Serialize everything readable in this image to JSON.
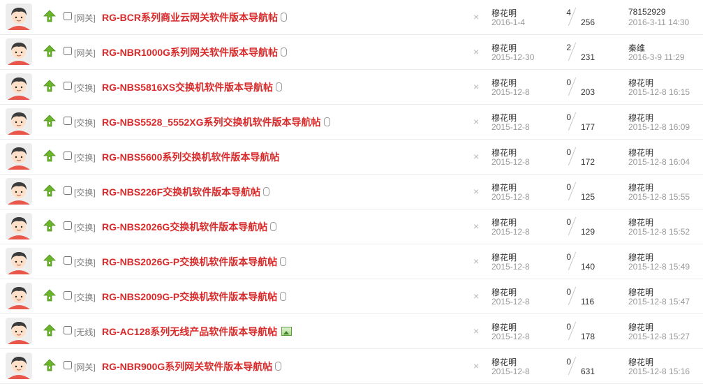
{
  "threads": [
    {
      "category": "[网关]",
      "title": "RG-BCR系列商业云网关软件版本导航帖",
      "attachment": "clip",
      "author": "穆花明",
      "post_date": "2016-1-4",
      "replies": "4",
      "views": "256",
      "last_user": "78152929",
      "last_time": "2016-3-11 14:30"
    },
    {
      "category": "[网关]",
      "title": "RG-NBR1000G系列网关软件版本导航帖",
      "attachment": "clip",
      "author": "穆花明",
      "post_date": "2015-12-30",
      "replies": "2",
      "views": "231",
      "last_user": "秦维",
      "last_time": "2016-3-9 11:29"
    },
    {
      "category": "[交换]",
      "title": "RG-NBS5816XS交换机软件版本导航帖",
      "attachment": "clip",
      "author": "穆花明",
      "post_date": "2015-12-8",
      "replies": "0",
      "views": "203",
      "last_user": "穆花明",
      "last_time": "2015-12-8 16:15"
    },
    {
      "category": "[交换]",
      "title": "RG-NBS5528_5552XG系列交换机软件版本导航帖",
      "attachment": "clip",
      "author": "穆花明",
      "post_date": "2015-12-8",
      "replies": "0",
      "views": "177",
      "last_user": "穆花明",
      "last_time": "2015-12-8 16:09"
    },
    {
      "category": "[交换]",
      "title": "RG-NBS5600系列交换机软件版本导航帖",
      "attachment": "none",
      "author": "穆花明",
      "post_date": "2015-12-8",
      "replies": "0",
      "views": "172",
      "last_user": "穆花明",
      "last_time": "2015-12-8 16:04"
    },
    {
      "category": "[交换]",
      "title": "RG-NBS226F交换机软件版本导航帖",
      "attachment": "clip",
      "author": "穆花明",
      "post_date": "2015-12-8",
      "replies": "0",
      "views": "125",
      "last_user": "穆花明",
      "last_time": "2015-12-8 15:55"
    },
    {
      "category": "[交换]",
      "title": "RG-NBS2026G交换机软件版本导航帖",
      "attachment": "clip",
      "author": "穆花明",
      "post_date": "2015-12-8",
      "replies": "0",
      "views": "129",
      "last_user": "穆花明",
      "last_time": "2015-12-8 15:52"
    },
    {
      "category": "[交换]",
      "title": "RG-NBS2026G-P交换机软件版本导航帖",
      "attachment": "clip",
      "author": "穆花明",
      "post_date": "2015-12-8",
      "replies": "0",
      "views": "140",
      "last_user": "穆花明",
      "last_time": "2015-12-8 15:49"
    },
    {
      "category": "[交换]",
      "title": "RG-NBS2009G-P交换机软件版本导航帖",
      "attachment": "clip",
      "author": "穆花明",
      "post_date": "2015-12-8",
      "replies": "0",
      "views": "116",
      "last_user": "穆花明",
      "last_time": "2015-12-8 15:47"
    },
    {
      "category": "[无线]",
      "title": "RG-AC128系列无线产品软件版本导航帖",
      "attachment": "image",
      "author": "穆花明",
      "post_date": "2015-12-8",
      "replies": "0",
      "views": "178",
      "last_user": "穆花明",
      "last_time": "2015-12-8 15:27"
    },
    {
      "category": "[网关]",
      "title": "RG-NBR900G系列网关软件版本导航帖",
      "attachment": "clip",
      "author": "穆花明",
      "post_date": "2015-12-8",
      "replies": "0",
      "views": "631",
      "last_user": "穆花明",
      "last_time": "2015-12-8 15:16"
    }
  ],
  "icons": {
    "avatar": "default-avatar-icon",
    "upvote": "green-up-arrow-icon",
    "delete": "close-icon",
    "attachment_clip": "paperclip-icon",
    "attachment_image": "image-icon"
  },
  "colors": {
    "title": "#d82a2a",
    "upvote": "#6bb52c",
    "muted": "#9a9a9a"
  }
}
